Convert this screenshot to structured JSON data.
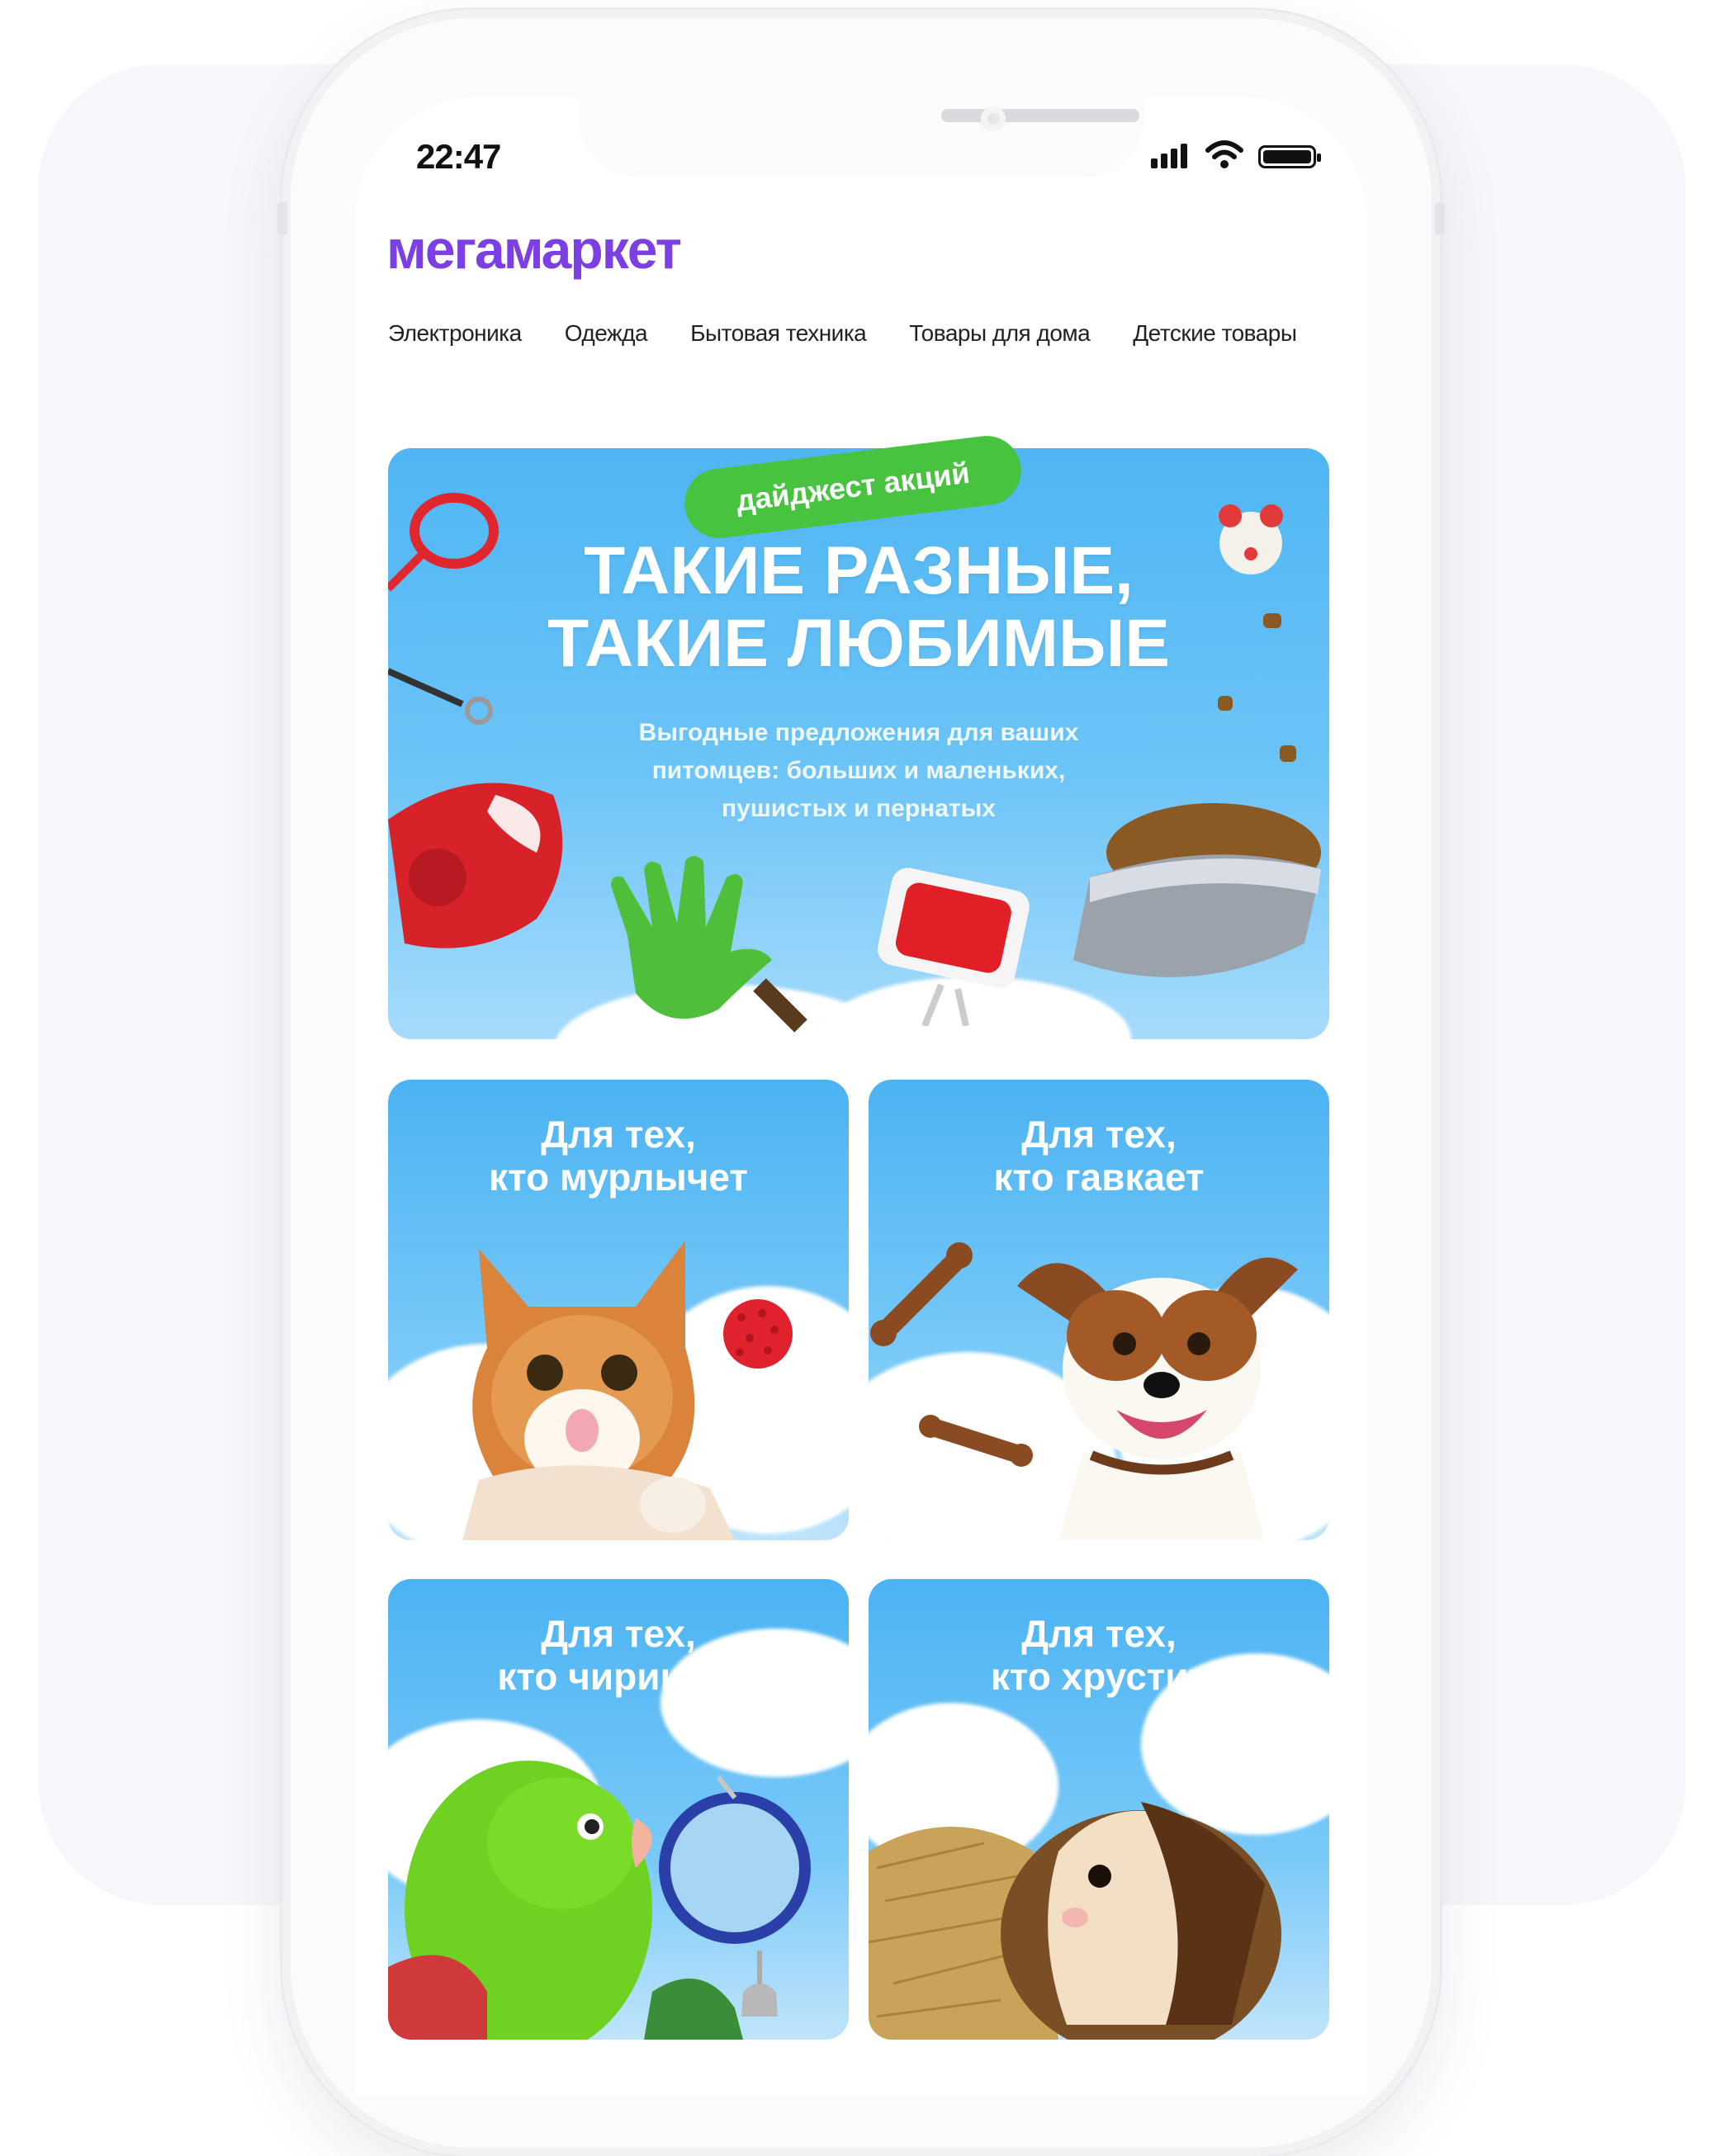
{
  "status_bar": {
    "time": "22:47"
  },
  "brand": {
    "logo_text": "мегамаркет",
    "accent": "#7b3fe4"
  },
  "nav": {
    "items": [
      "Электроника",
      "Одежда",
      "Бытовая техника",
      "Товары для дома",
      "Детские товары"
    ]
  },
  "hero": {
    "badge": "дайджест акций",
    "title_line1": "ТАКИЕ РАЗНЫЕ,",
    "title_line2": "ТАКИЕ ЛЮБИМЫЕ",
    "subtitle_line1": "Выгодные предложения для ваших",
    "subtitle_line2": "питомцев: больших и маленьких,",
    "subtitle_line3": "пушистых и пернатых",
    "badge_color": "#47c33f"
  },
  "cards": [
    {
      "line1": "Для тех,",
      "line2": "кто мурлычет"
    },
    {
      "line1": "Для тех,",
      "line2": "кто гавкает"
    },
    {
      "line1": "Для тех,",
      "line2": "кто чирикает"
    },
    {
      "line1": "Для тех,",
      "line2": "кто хрустит"
    }
  ]
}
